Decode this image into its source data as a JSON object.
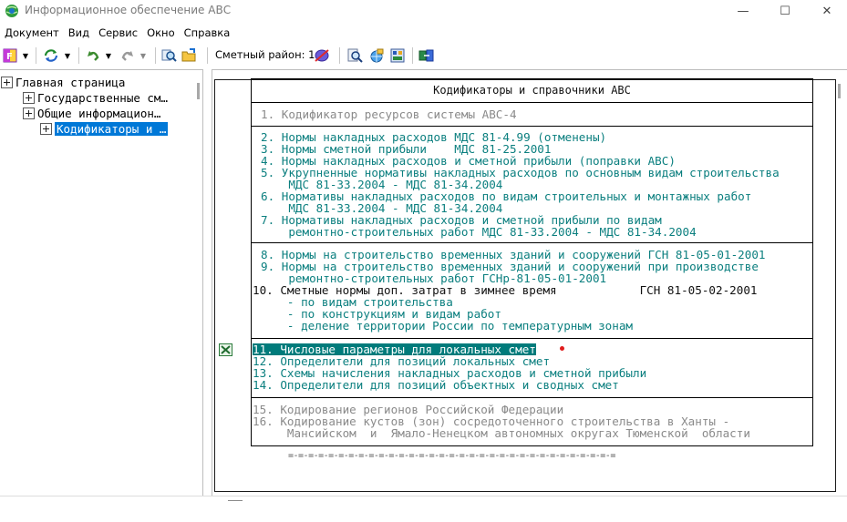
{
  "window": {
    "title": "Информационное обеспечение АВС",
    "minimize_glyph": "—",
    "maximize_glyph": "☐",
    "close_glyph": "✕"
  },
  "menu": {
    "items": [
      "Документ",
      "Вид",
      "Сервис",
      "Окно",
      "Справка"
    ]
  },
  "toolbar": {
    "district_label": "Сметный район: 1",
    "icons": [
      "app-menu-icon",
      "refresh-icon",
      "undo-icon",
      "redo-icon",
      "search-icon",
      "open-folder-icon",
      "district-icon",
      "zoom-icon",
      "web-search-icon",
      "settings-icon",
      "export-icon"
    ]
  },
  "tree": {
    "items": [
      {
        "label": "Главная страница"
      },
      {
        "label": "Государственные см…"
      },
      {
        "label": "Общие информацион…"
      },
      {
        "label": "Кодификаторы и …"
      }
    ]
  },
  "doc": {
    "header": "Кодификаторы и справочники АВС",
    "section1": [
      "1. Кодификатор ресурсов системы АВС-4"
    ],
    "section2": [
      "2. Нормы накладных расходов МДС 81-4.99 (отменены)",
      "3. Нормы сметной прибыли    МДС 81-25.2001",
      "4. Нормы накладных расходов и сметной прибыли (поправки АВС)",
      "5. Укрупненные нормативы накладных расходов по основным видам строительства",
      "    МДС 81-33.2004 - МДС 81-34.2004",
      "6. Нормативы накладных расходов по видам строительных и монтажных работ",
      "    МДС 81-33.2004 - МДС 81-34.2004",
      "7. Нормативы накладных расходов и сметной прибыли по видам",
      "    ремонтно-строительных работ МДС 81-33.2004 - МДС 81-34.2004"
    ],
    "section3_teal": [
      "8. Нормы на строительство временных зданий и сооружений ГСН 81-05-01-2001",
      "9. Нормы на строительство временных зданий и сооружений при производстве",
      "    ремонтно-строительных работ ГСНр-81-05-01-2001"
    ],
    "section3_black": "10. Сметные нормы доп. затрат в зимнее время            ГСН 81-05-02-2001",
    "section3_sub": [
      "     - по видам строительства",
      "     - по конструкциям и видам работ",
      "     - деление территории России по температурным зонам"
    ],
    "section4_selected": "11. Числовые параметры для локальных смет",
    "section4": [
      "12. Определители для позиций локальных смет",
      "13. Схемы начисления накладных расходов и сметной прибыли",
      "14. Определители для позиций объектных и сводных смет"
    ],
    "section5": [
      "15. Кодирование регионов Российской Федерации",
      "16. Кодирование кустов (зон) сосредоточенного строительства в Ханты -",
      "     Мансийском  и  Ямало-Ненецком автономных округах Тюменской  области"
    ],
    "footer_dashes": "=-=-=-=-=-=-=-=-=-=-=-=-=-=-=-=-=-=-=-=-=-=-=-=-=-=-=-=-=-=-=-=-="
  },
  "colors": {
    "teal": "#0b7f7f",
    "gray": "#8a8a8a",
    "selection": "#007b7b",
    "tree_selection": "#0078d7"
  }
}
